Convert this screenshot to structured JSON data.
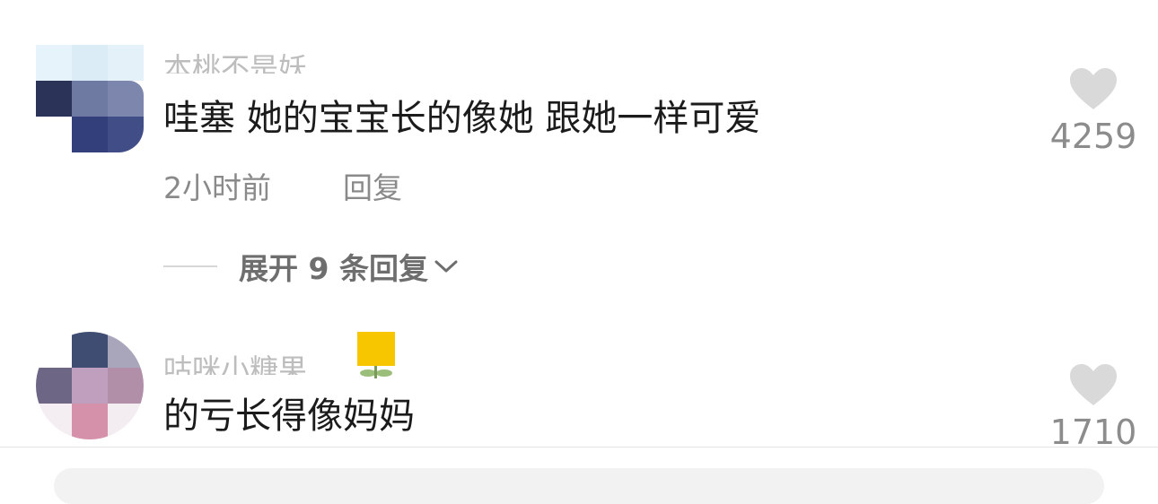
{
  "comments": [
    {
      "username": "本桃不是妖",
      "text": "哇塞 她的宝宝长的像她 跟她一样可爱",
      "time": "2小时前",
      "reply_label": "回复",
      "expand_label": "展开 9 条回复",
      "like_count": "4259"
    },
    {
      "username": "咕咪小糖果",
      "text": "的亏长得像妈妈",
      "like_count": "1710"
    }
  ],
  "icons": {
    "like": "heart-icon",
    "expand": "chevron-down-icon"
  },
  "colors": {
    "text_primary": "#1b1b1b",
    "text_secondary": "#8a8a8a",
    "heart": "#d9d9d9",
    "badge": "#f7c600"
  }
}
